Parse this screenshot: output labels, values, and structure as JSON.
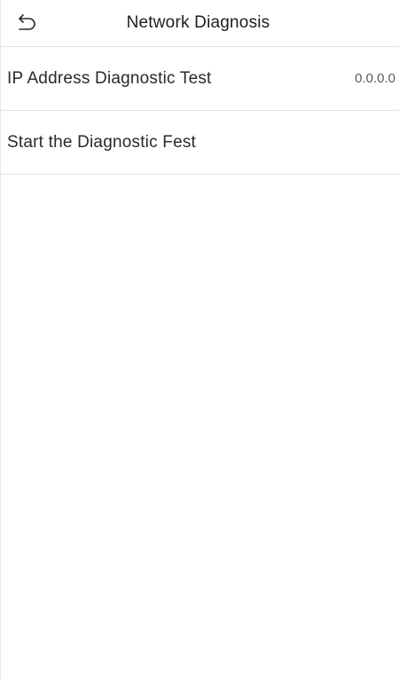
{
  "header": {
    "back_icon": "back-arrow-icon",
    "title": "Network Diagnosis"
  },
  "items": [
    {
      "label": "IP Address Diagnostic Test",
      "value": "0.0.0.0"
    },
    {
      "label": "Start the Diagnostic Fest"
    }
  ],
  "colors": {
    "background": "#ffffff",
    "divider": "#e2e2e2",
    "text": "#1e1e1e",
    "value_text": "#5a5a5a"
  }
}
